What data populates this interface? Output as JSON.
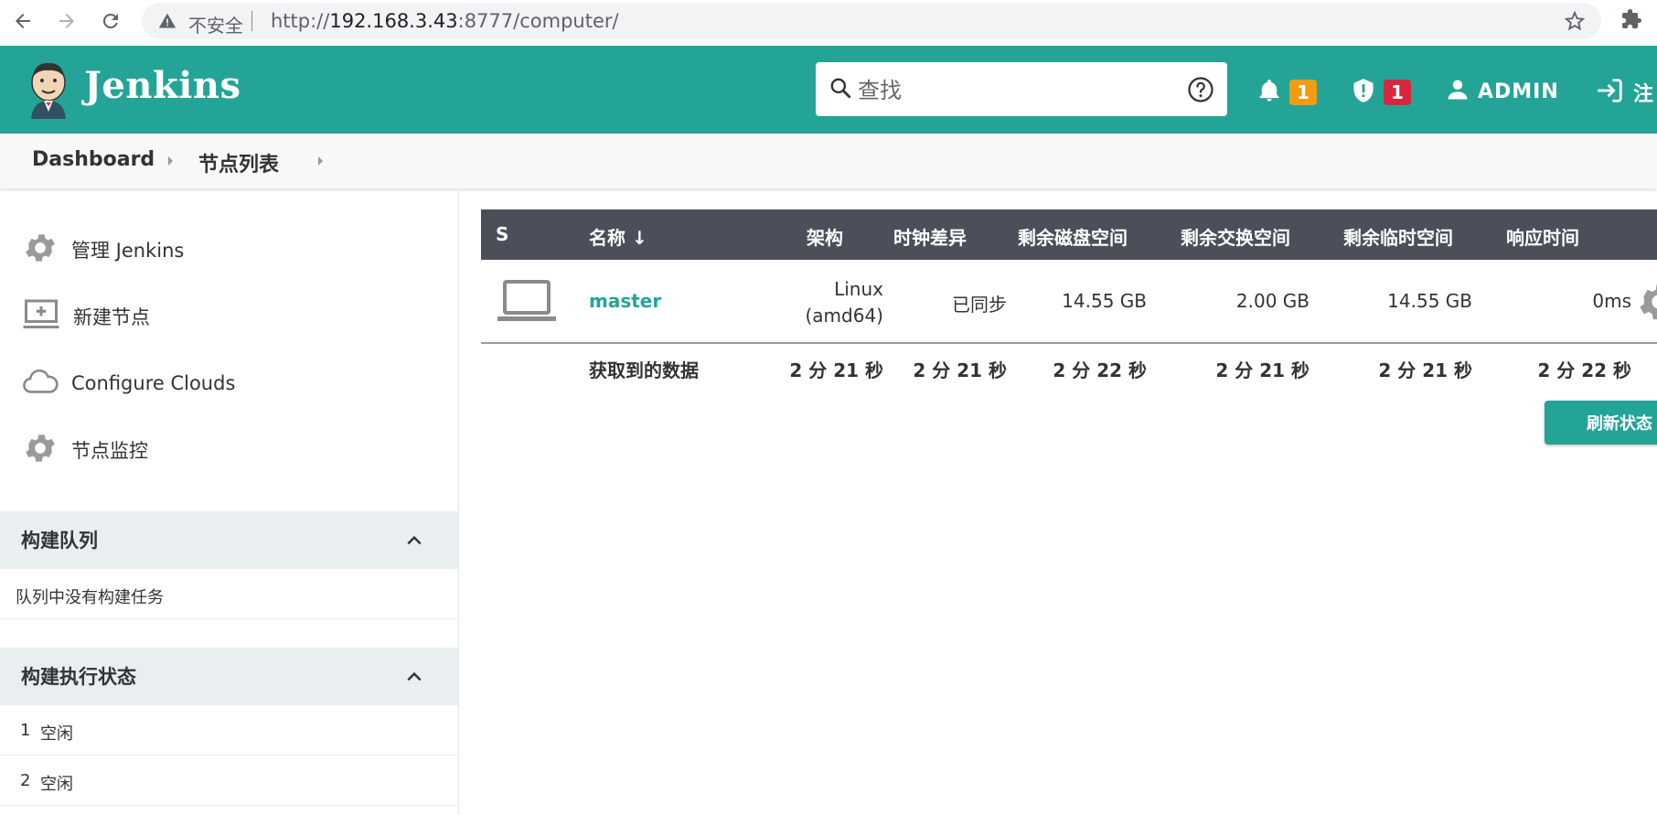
{
  "browser": {
    "insecure_label": "不安全",
    "url_prefix": "http://",
    "url_host": "192.168.3.43",
    "url_rest": ":8777/computer/"
  },
  "header": {
    "brand": "Jenkins",
    "search_placeholder": "查找",
    "notifications_count": "1",
    "security_count": "1",
    "user": "ADMIN",
    "logout": "注"
  },
  "breadcrumb": {
    "items": [
      {
        "label": "Dashboard"
      },
      {
        "label": "节点列表"
      }
    ]
  },
  "sidebar": {
    "tasks": [
      {
        "label": "管理 Jenkins",
        "icon": "gear-icon"
      },
      {
        "label": "新建节点",
        "icon": "computer-add-icon"
      },
      {
        "label": "Configure Clouds",
        "icon": "cloud-icon"
      },
      {
        "label": "节点监控",
        "icon": "gear-icon"
      }
    ],
    "build_queue": {
      "title": "构建队列",
      "empty_text": "队列中没有构建任务"
    },
    "executors": {
      "title": "构建执行状态",
      "items": [
        {
          "num": "1",
          "status": "空闲"
        },
        {
          "num": "2",
          "status": "空闲"
        }
      ]
    }
  },
  "table": {
    "headers": {
      "s": "S",
      "name": "名称 ↓",
      "arch": "架构",
      "clock": "时钟差异",
      "disk": "剩余磁盘空间",
      "swap": "剩余交换空间",
      "temp": "剩余临时空间",
      "response": "响应时间"
    },
    "rows": [
      {
        "name": "master",
        "arch_line1": "Linux",
        "arch_line2": "(amd64)",
        "clock": "已同步",
        "disk": "14.55 GB",
        "swap": "2.00 GB",
        "temp": "14.55 GB",
        "response": "0ms"
      }
    ],
    "footer": {
      "label": "获取到的数据",
      "arch": "2 分 21 秒",
      "clock": "2 分 21 秒",
      "disk": "2 分 22 秒",
      "swap": "2 分 21 秒",
      "temp": "2 分 21 秒",
      "response": "2 分 22 秒"
    },
    "refresh_label": "刷新状态"
  },
  "colors": {
    "brand": "#24a497",
    "table_header": "#4a4f59",
    "badge_warning": "#f39c12",
    "badge_danger": "#d9263f"
  }
}
